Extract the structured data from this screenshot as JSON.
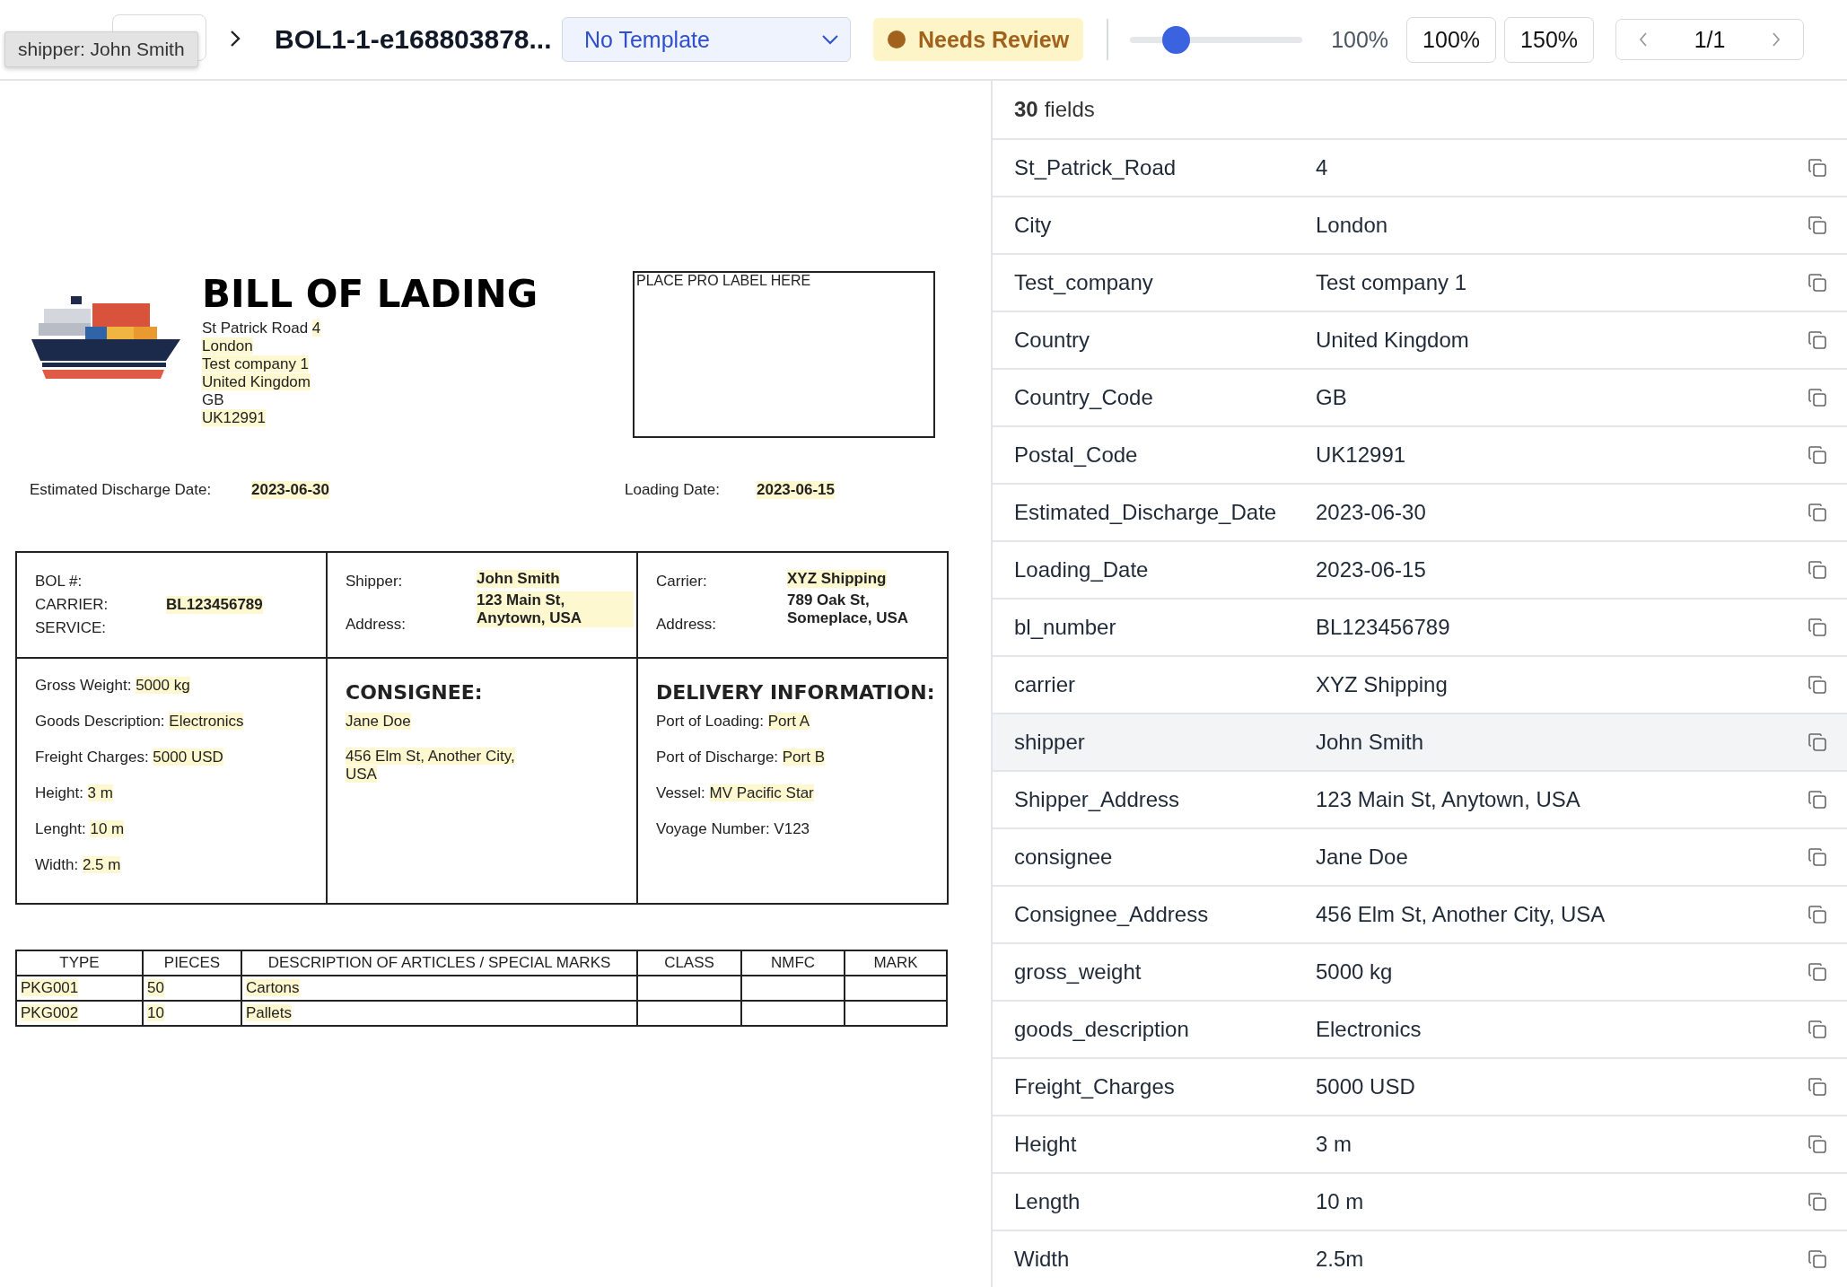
{
  "toolbar": {
    "tooltip": "shipper: John Smith",
    "document_title": "BOL1-1-e168803878...",
    "template_select": {
      "value": "No Template"
    },
    "status_badge": {
      "label": "Needs Review"
    },
    "zoom_slider": {
      "level": 0.27
    },
    "zoom_reading": "100%",
    "zoom_buttons": [
      "100%",
      "150%"
    ],
    "pager": {
      "label": "1/1"
    }
  },
  "document": {
    "title": "BILL OF LADING",
    "address_lines": [
      {
        "label": "St Patrick Road ",
        "value": "4",
        "highlighted": true
      },
      {
        "value": "London",
        "highlighted": true
      },
      {
        "value": "Test company 1",
        "highlighted": true
      },
      {
        "value": "United Kingdom",
        "highlighted": true
      },
      {
        "value": "GB",
        "highlighted": false
      },
      {
        "value": "UK12991",
        "highlighted": true
      }
    ],
    "pro_label": "PLACE PRO LABEL HERE",
    "dates": [
      {
        "label": "Estimated Discharge Date:",
        "value": "2023-06-30",
        "highlighted": true
      },
      {
        "label": "Loading Date:",
        "value": "2023-06-15",
        "highlighted": true
      }
    ],
    "info_cells": [
      {
        "labels": [
          "BOL #:",
          "CARRIER:",
          "SERVICE:"
        ],
        "values": [
          {
            "text": "BL123456789",
            "highlighted": true
          }
        ]
      },
      {
        "labels": [
          "Shipper:",
          "Address:"
        ],
        "values": [
          {
            "text": "John Smith",
            "highlighted": true
          },
          {
            "text": "123 Main St, Anytown, USA",
            "highlighted": true
          }
        ]
      },
      {
        "labels": [
          "Carrier:",
          "Address:"
        ],
        "values": [
          {
            "text": "XYZ Shipping",
            "highlighted": true
          },
          {
            "text": "789 Oak St, Someplace, USA",
            "highlighted": false
          }
        ]
      }
    ],
    "cargo_lines": [
      {
        "label": "Gross Weight: ",
        "value": "5000 kg",
        "highlighted": true
      },
      {
        "label": "Goods Description: ",
        "value": "Electronics",
        "highlighted": true
      },
      {
        "label": "Freight Charges: ",
        "value": "5000 USD",
        "highlighted": true
      },
      {
        "label": "Height: ",
        "value": "3 m",
        "highlighted": true
      },
      {
        "label": "Lenght: ",
        "value": "10 m",
        "highlighted": true
      },
      {
        "label": "Width: ",
        "value": "2.5 m",
        "highlighted": true
      }
    ],
    "consignee": {
      "heading": "CONSIGNEE:",
      "lines": [
        {
          "value": "Jane Doe",
          "highlighted": true
        },
        {
          "value": "456 Elm St, Another City, USA",
          "highlighted": true
        }
      ]
    },
    "delivery": {
      "heading": "DELIVERY INFORMATION:",
      "lines": [
        {
          "label": "Port of Loading: ",
          "value": "Port A",
          "highlighted": true
        },
        {
          "label": "Port of Discharge: ",
          "value": "Port B",
          "highlighted": true
        },
        {
          "label": "Vessel: ",
          "value": "MV Pacific Star",
          "highlighted": true
        },
        {
          "label": "Voyage Number: ",
          "value": "V123",
          "highlighted": false
        }
      ]
    },
    "items_table": {
      "columns": [
        "TYPE",
        "PIECES",
        "DESCRIPTION OF ARTICLES / SPECIAL MARKS",
        "CLASS",
        "NMFC",
        "MARK"
      ],
      "rows": [
        [
          {
            "text": "PKG001",
            "highlighted": true
          },
          {
            "text": "50",
            "highlighted": true
          },
          {
            "text": "Cartons",
            "highlighted": true
          }
        ],
        [
          {
            "text": "PKG002",
            "highlighted": true
          },
          {
            "text": "10",
            "highlighted": true
          },
          {
            "text": "Pallets",
            "highlighted": true
          }
        ]
      ]
    }
  },
  "fields_panel": {
    "count": "30",
    "count_label": "fields",
    "rows": [
      {
        "name": "St_Patrick_Road",
        "value": "4",
        "selected": false
      },
      {
        "name": "City",
        "value": "London",
        "selected": false
      },
      {
        "name": "Test_company",
        "value": "Test company 1",
        "selected": false
      },
      {
        "name": "Country",
        "value": "United Kingdom",
        "selected": false
      },
      {
        "name": "Country_Code",
        "value": "GB",
        "selected": false
      },
      {
        "name": "Postal_Code",
        "value": "UK12991",
        "selected": false
      },
      {
        "name": "Estimated_Discharge_Date",
        "value": "2023-06-30",
        "selected": false
      },
      {
        "name": "Loading_Date",
        "value": "2023-06-15",
        "selected": false
      },
      {
        "name": "bl_number",
        "value": "BL123456789",
        "selected": false
      },
      {
        "name": "carrier",
        "value": "XYZ Shipping",
        "selected": false
      },
      {
        "name": "shipper",
        "value": "John Smith",
        "selected": true
      },
      {
        "name": "Shipper_Address",
        "value": "123 Main St, Anytown, USA",
        "selected": false
      },
      {
        "name": "consignee",
        "value": "Jane Doe",
        "selected": false
      },
      {
        "name": "Consignee_Address",
        "value": "456 Elm St, Another City, USA",
        "selected": false
      },
      {
        "name": "gross_weight",
        "value": "5000 kg",
        "selected": false
      },
      {
        "name": "goods_description",
        "value": "Electronics",
        "selected": false
      },
      {
        "name": "Freight_Charges",
        "value": "5000 USD",
        "selected": false
      },
      {
        "name": "Height",
        "value": "3 m",
        "selected": false
      },
      {
        "name": "Length",
        "value": "10 m",
        "selected": false
      },
      {
        "name": "Width",
        "value": "2.5m",
        "selected": false
      }
    ]
  }
}
